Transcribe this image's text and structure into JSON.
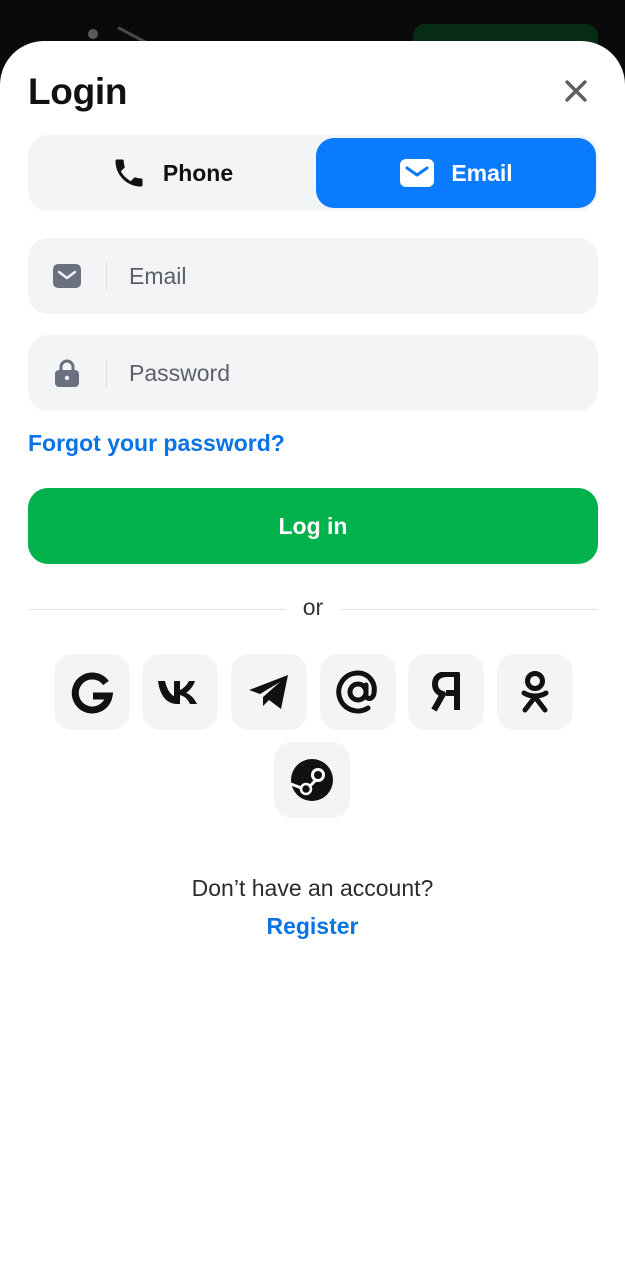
{
  "header": {
    "title": "Login"
  },
  "tabs": {
    "phone_label": "Phone",
    "email_label": "Email",
    "selected": "Email"
  },
  "form": {
    "email_placeholder": "Email",
    "email_value": "",
    "password_placeholder": "Password",
    "password_value": "",
    "forgot_label": "Forgot your password?",
    "submit_label": "Log in"
  },
  "divider": {
    "label": "or"
  },
  "social": {
    "items": [
      "google-icon",
      "vk-icon",
      "telegram-icon",
      "mail-ru-icon",
      "yandex-icon",
      "odnoklassniki-icon",
      "steam-icon"
    ]
  },
  "footer": {
    "question": "Don’t have an account?",
    "register_label": "Register"
  },
  "colors": {
    "accent": "#0a7bff",
    "link": "#0a73e6",
    "primary_button": "#00b14c",
    "field_bg": "#f3f4f5"
  }
}
